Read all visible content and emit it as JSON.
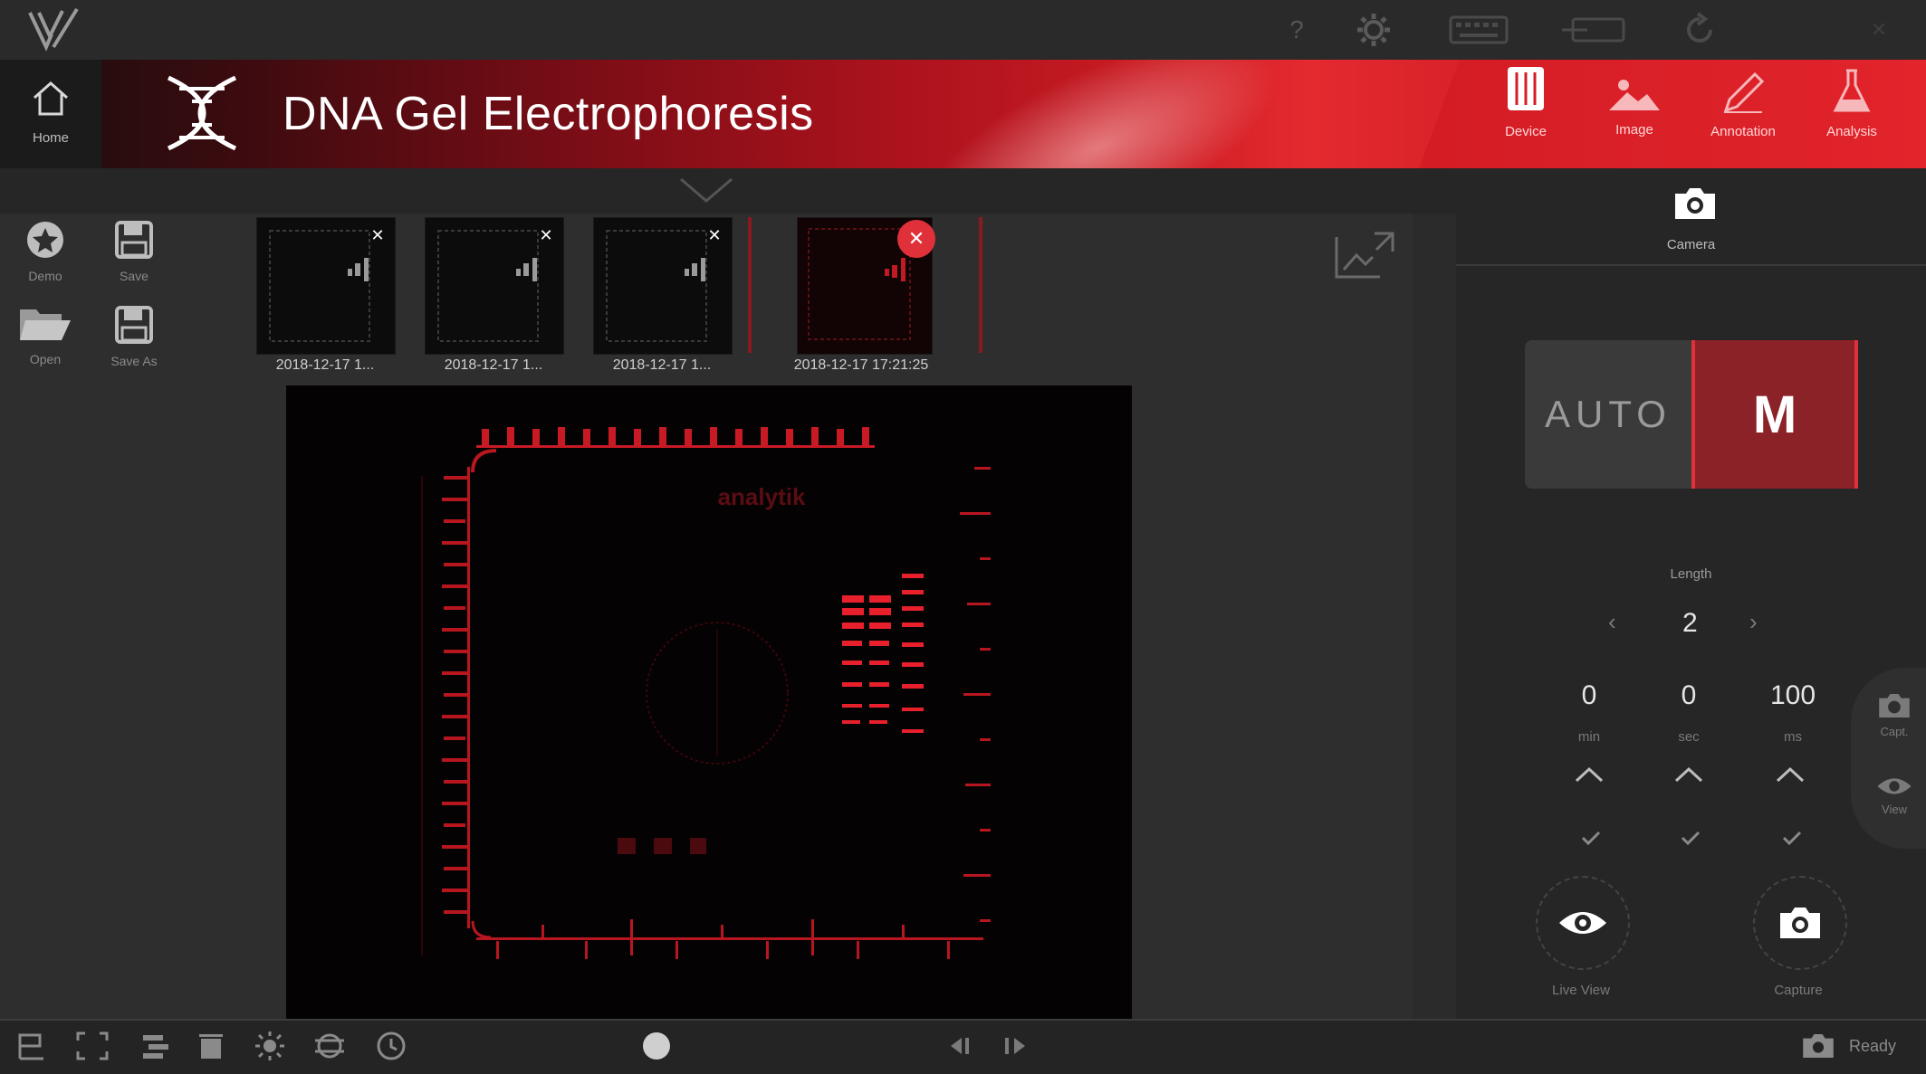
{
  "header": {
    "title": "DNA Gel Electrophoresis",
    "home_label": "Home",
    "modes": [
      {
        "label": "Device",
        "icon": "device-icon"
      },
      {
        "label": "Image",
        "icon": "image-icon"
      },
      {
        "label": "Annotation",
        "icon": "annotation-icon"
      },
      {
        "label": "Analysis",
        "icon": "analysis-icon"
      }
    ]
  },
  "left_tools": {
    "demo": "Demo",
    "save": "Save",
    "open": "Open",
    "save_as": "Save As"
  },
  "thumbnails": [
    {
      "name": "2018-12-17 1..."
    },
    {
      "name": "2018-12-17 1..."
    },
    {
      "name": "2018-12-17 1..."
    },
    {
      "name": "2018-12-17 17:21:25"
    }
  ],
  "gel": {
    "watermark": "analytik"
  },
  "right_panel": {
    "camera_label": "Camera",
    "auto_label": "AUTO",
    "manual_label": "M",
    "exposure_label": "Length",
    "exposure_value": "2",
    "time_fields": [
      {
        "value": "0",
        "unit": "min"
      },
      {
        "value": "0",
        "unit": "sec"
      },
      {
        "value": "100",
        "unit": "ms"
      }
    ],
    "live_view_label": "Live View",
    "capture_label": "Capture",
    "flyout_capture": "Capt.",
    "flyout_view": "View"
  },
  "status": {
    "label": "Ready"
  },
  "colors": {
    "accent": "#e0313a",
    "manual_bg": "#8b2228",
    "gel_band": "#e8202c"
  }
}
